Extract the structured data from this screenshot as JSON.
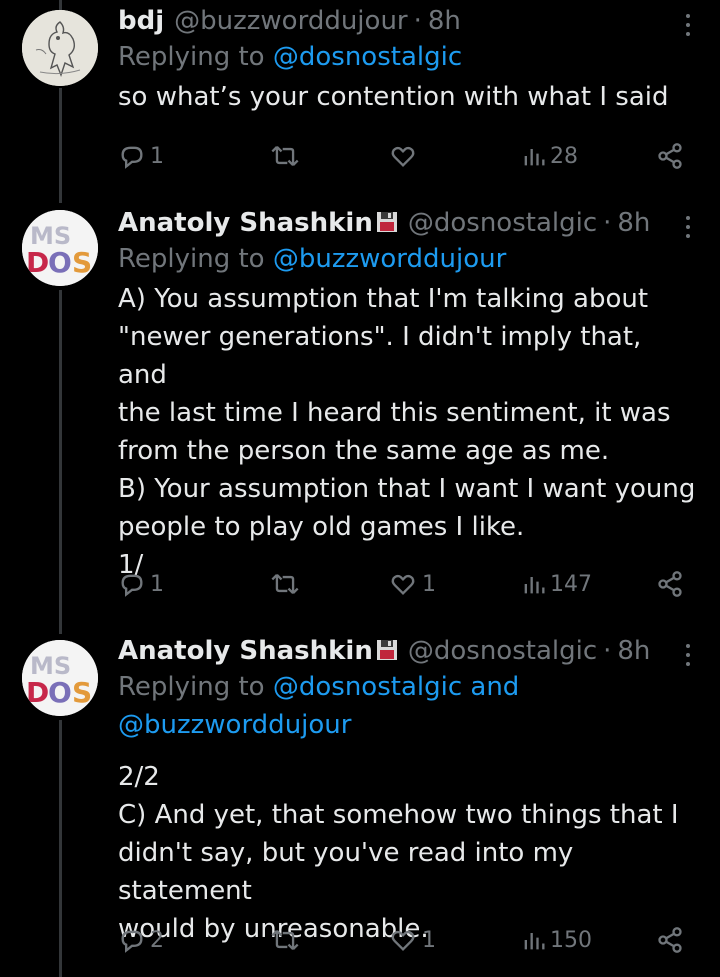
{
  "tweets": [
    {
      "name": "bdj",
      "handle": "@buzzworddujour",
      "separator": "·",
      "time": "8h",
      "replying_prefix": "Replying to",
      "replying_to": "@dosnostalgic",
      "replying_to_line2": "",
      "text": "so what’s your contention with what I said",
      "replies": "1",
      "retweets": "",
      "likes": "",
      "views": "28"
    },
    {
      "name": "Anatoly Shashkin",
      "handle": "@dosnostalgic",
      "separator": "·",
      "time": "8h",
      "replying_prefix": "Replying to",
      "replying_to": "@buzzworddujour",
      "replying_to_line2": "",
      "text": "A) You assumption that I'm talking about\n\"newer generations\". I didn't imply that, and\nthe last time I heard this sentiment, it was\nfrom the person the same age as me.\nB) Your assumption that I want I want young\npeople to play old games I like.\n1/",
      "replies": "1",
      "retweets": "",
      "likes": "1",
      "views": "147"
    },
    {
      "name": "Anatoly Shashkin",
      "handle": "@dosnostalgic",
      "separator": "·",
      "time": "8h",
      "replying_prefix": "Replying to",
      "replying_to": "@dosnostalgic and",
      "replying_to_line2": "@buzzworddujour",
      "text": "2/2\nC) And yet, that somehow two things that I\ndidn't say, but you've read into my statement\nwould by unreasonable.",
      "replies": "2",
      "retweets": "",
      "likes": "1",
      "views": "150"
    }
  ],
  "colors": {
    "background": "#000000",
    "text": "#e7e9ea",
    "muted": "#71767b",
    "link": "#1d9bf0",
    "thread_line": "#333639"
  },
  "icons": [
    "reply-icon",
    "retweet-icon",
    "like-icon",
    "views-icon",
    "share-icon",
    "more-options-icon",
    "floppy-disk-emoji"
  ]
}
